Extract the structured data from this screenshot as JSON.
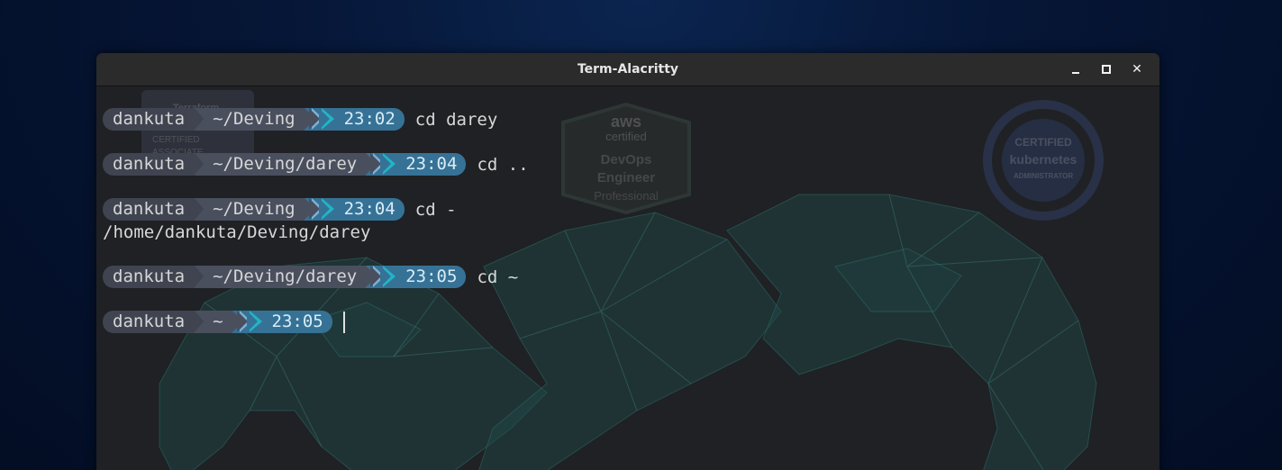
{
  "window": {
    "title": "Term-Alacritty",
    "controls": {
      "minimize": "minimize",
      "maximize": "maximize",
      "close": "close"
    }
  },
  "wallpaper": {
    "badges": {
      "terraform": [
        "Terraform",
        "CERTIFIED",
        "ASSOCIATE"
      ],
      "aws": [
        "aws",
        "certified",
        "DevOps",
        "Engineer",
        "Professional"
      ],
      "kubernetes": [
        "CERTIFIED",
        "kubernetes",
        "ADMINISTRATOR"
      ]
    }
  },
  "terminal": {
    "entries": [
      {
        "user": "dankuta",
        "path": "~/Deving",
        "time": "23:02",
        "command": "cd darey",
        "output": ""
      },
      {
        "user": "dankuta",
        "path": "~/Deving/darey",
        "time": "23:04",
        "command": "cd ..",
        "output": ""
      },
      {
        "user": "dankuta",
        "path": "~/Deving",
        "time": "23:04",
        "command": "cd -",
        "output": "/home/dankuta/Deving/darey"
      },
      {
        "user": "dankuta",
        "path": "~/Deving/darey",
        "time": "23:05",
        "command": "cd ~",
        "output": ""
      },
      {
        "user": "dankuta",
        "path": "~",
        "time": "23:05",
        "command": "",
        "output": ""
      }
    ]
  },
  "colors": {
    "user_segment": "#3f4450",
    "path_segment": "#4a4f5e",
    "time_segment": "#367296",
    "accent_cyan": "#21b5c6",
    "terminal_bg": "#1f2124"
  }
}
